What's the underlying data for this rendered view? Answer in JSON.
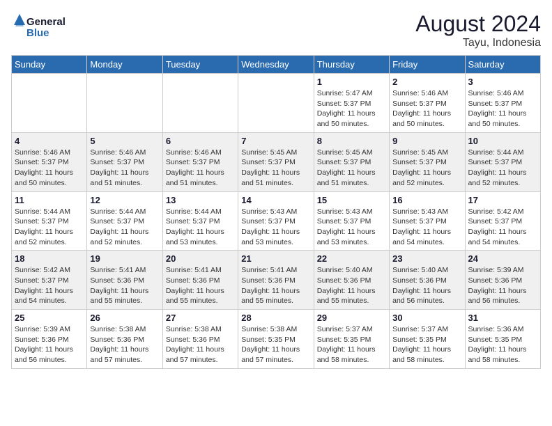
{
  "header": {
    "logo_line1": "General",
    "logo_line2": "Blue",
    "month_year": "August 2024",
    "location": "Tayu, Indonesia"
  },
  "days_of_week": [
    "Sunday",
    "Monday",
    "Tuesday",
    "Wednesday",
    "Thursday",
    "Friday",
    "Saturday"
  ],
  "weeks": [
    [
      {
        "day": "",
        "info": ""
      },
      {
        "day": "",
        "info": ""
      },
      {
        "day": "",
        "info": ""
      },
      {
        "day": "",
        "info": ""
      },
      {
        "day": "1",
        "info": "Sunrise: 5:47 AM\nSunset: 5:37 PM\nDaylight: 11 hours\nand 50 minutes."
      },
      {
        "day": "2",
        "info": "Sunrise: 5:46 AM\nSunset: 5:37 PM\nDaylight: 11 hours\nand 50 minutes."
      },
      {
        "day": "3",
        "info": "Sunrise: 5:46 AM\nSunset: 5:37 PM\nDaylight: 11 hours\nand 50 minutes."
      }
    ],
    [
      {
        "day": "4",
        "info": "Sunrise: 5:46 AM\nSunset: 5:37 PM\nDaylight: 11 hours\nand 50 minutes."
      },
      {
        "day": "5",
        "info": "Sunrise: 5:46 AM\nSunset: 5:37 PM\nDaylight: 11 hours\nand 51 minutes."
      },
      {
        "day": "6",
        "info": "Sunrise: 5:46 AM\nSunset: 5:37 PM\nDaylight: 11 hours\nand 51 minutes."
      },
      {
        "day": "7",
        "info": "Sunrise: 5:45 AM\nSunset: 5:37 PM\nDaylight: 11 hours\nand 51 minutes."
      },
      {
        "day": "8",
        "info": "Sunrise: 5:45 AM\nSunset: 5:37 PM\nDaylight: 11 hours\nand 51 minutes."
      },
      {
        "day": "9",
        "info": "Sunrise: 5:45 AM\nSunset: 5:37 PM\nDaylight: 11 hours\nand 52 minutes."
      },
      {
        "day": "10",
        "info": "Sunrise: 5:44 AM\nSunset: 5:37 PM\nDaylight: 11 hours\nand 52 minutes."
      }
    ],
    [
      {
        "day": "11",
        "info": "Sunrise: 5:44 AM\nSunset: 5:37 PM\nDaylight: 11 hours\nand 52 minutes."
      },
      {
        "day": "12",
        "info": "Sunrise: 5:44 AM\nSunset: 5:37 PM\nDaylight: 11 hours\nand 52 minutes."
      },
      {
        "day": "13",
        "info": "Sunrise: 5:44 AM\nSunset: 5:37 PM\nDaylight: 11 hours\nand 53 minutes."
      },
      {
        "day": "14",
        "info": "Sunrise: 5:43 AM\nSunset: 5:37 PM\nDaylight: 11 hours\nand 53 minutes."
      },
      {
        "day": "15",
        "info": "Sunrise: 5:43 AM\nSunset: 5:37 PM\nDaylight: 11 hours\nand 53 minutes."
      },
      {
        "day": "16",
        "info": "Sunrise: 5:43 AM\nSunset: 5:37 PM\nDaylight: 11 hours\nand 54 minutes."
      },
      {
        "day": "17",
        "info": "Sunrise: 5:42 AM\nSunset: 5:37 PM\nDaylight: 11 hours\nand 54 minutes."
      }
    ],
    [
      {
        "day": "18",
        "info": "Sunrise: 5:42 AM\nSunset: 5:37 PM\nDaylight: 11 hours\nand 54 minutes."
      },
      {
        "day": "19",
        "info": "Sunrise: 5:41 AM\nSunset: 5:36 PM\nDaylight: 11 hours\nand 55 minutes."
      },
      {
        "day": "20",
        "info": "Sunrise: 5:41 AM\nSunset: 5:36 PM\nDaylight: 11 hours\nand 55 minutes."
      },
      {
        "day": "21",
        "info": "Sunrise: 5:41 AM\nSunset: 5:36 PM\nDaylight: 11 hours\nand 55 minutes."
      },
      {
        "day": "22",
        "info": "Sunrise: 5:40 AM\nSunset: 5:36 PM\nDaylight: 11 hours\nand 55 minutes."
      },
      {
        "day": "23",
        "info": "Sunrise: 5:40 AM\nSunset: 5:36 PM\nDaylight: 11 hours\nand 56 minutes."
      },
      {
        "day": "24",
        "info": "Sunrise: 5:39 AM\nSunset: 5:36 PM\nDaylight: 11 hours\nand 56 minutes."
      }
    ],
    [
      {
        "day": "25",
        "info": "Sunrise: 5:39 AM\nSunset: 5:36 PM\nDaylight: 11 hours\nand 56 minutes."
      },
      {
        "day": "26",
        "info": "Sunrise: 5:38 AM\nSunset: 5:36 PM\nDaylight: 11 hours\nand 57 minutes."
      },
      {
        "day": "27",
        "info": "Sunrise: 5:38 AM\nSunset: 5:36 PM\nDaylight: 11 hours\nand 57 minutes."
      },
      {
        "day": "28",
        "info": "Sunrise: 5:38 AM\nSunset: 5:35 PM\nDaylight: 11 hours\nand 57 minutes."
      },
      {
        "day": "29",
        "info": "Sunrise: 5:37 AM\nSunset: 5:35 PM\nDaylight: 11 hours\nand 58 minutes."
      },
      {
        "day": "30",
        "info": "Sunrise: 5:37 AM\nSunset: 5:35 PM\nDaylight: 11 hours\nand 58 minutes."
      },
      {
        "day": "31",
        "info": "Sunrise: 5:36 AM\nSunset: 5:35 PM\nDaylight: 11 hours\nand 58 minutes."
      }
    ]
  ]
}
